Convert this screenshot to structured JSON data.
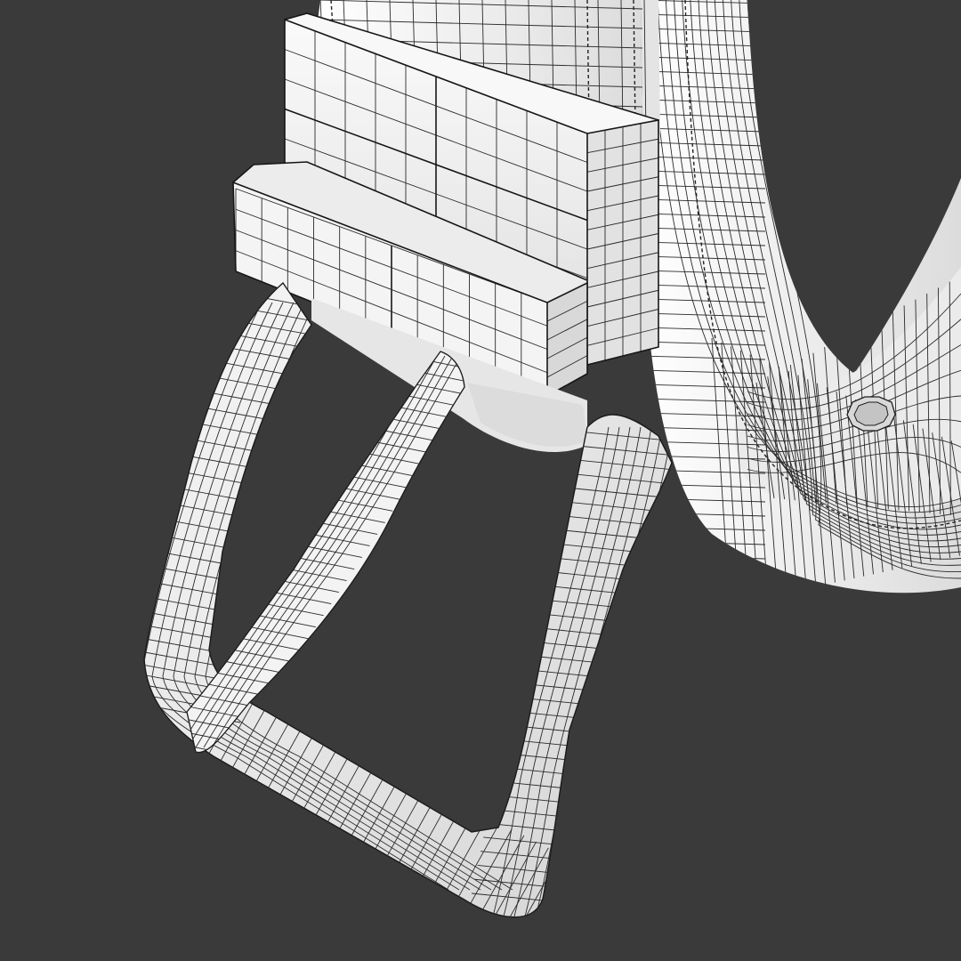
{
  "scene": {
    "subject": "belt-buckle-wireframe-render",
    "background_color": "#3a3a3a",
    "surface_color": "#f2f2f2",
    "shadow_color": "#cfcfcf",
    "wire_color": "#1e1e1e"
  }
}
